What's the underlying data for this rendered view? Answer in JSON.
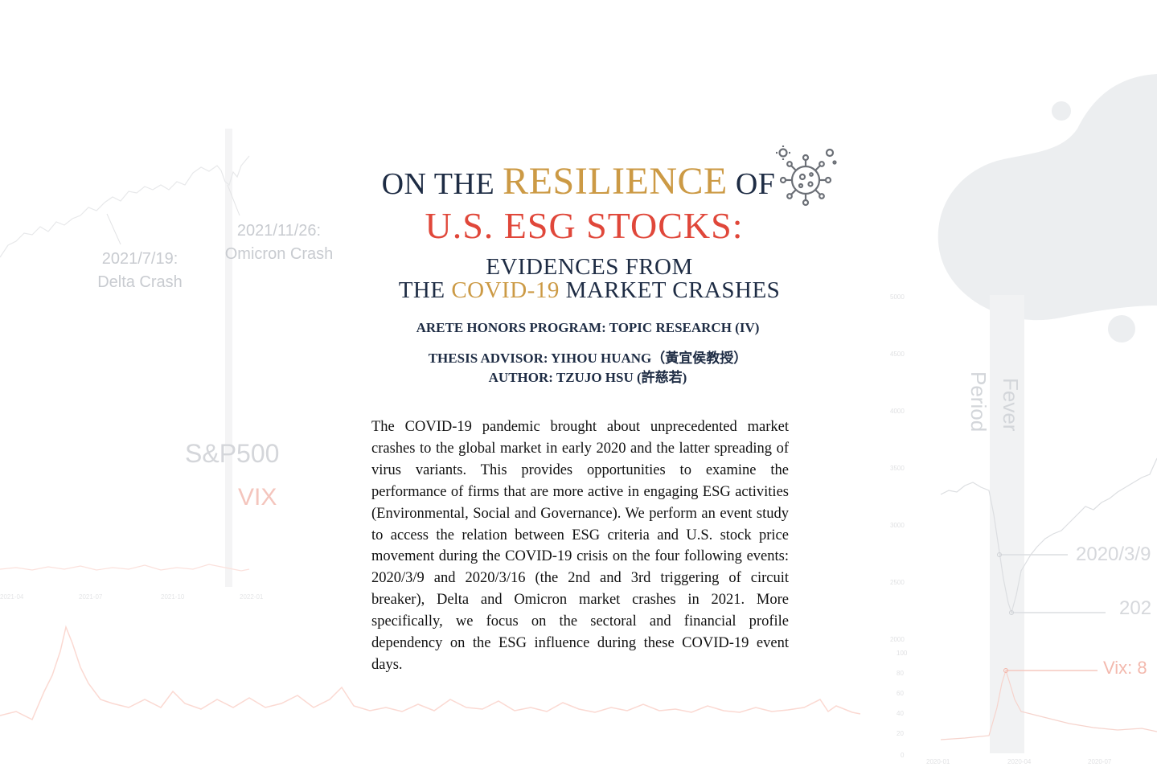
{
  "title": {
    "prefix": "ON THE",
    "highlight": "RESILIENCE",
    "suffix": "OF",
    "line2": "U.S. ESG STOCKS:"
  },
  "subtitle": {
    "line1": "EVIDENCES FROM",
    "line2_prefix": "THE",
    "line2_highlight": "COVID-19",
    "line2_suffix": "MARKET CRASHES"
  },
  "program": "ARETE HONORS PROGRAM: TOPIC RESEARCH (IV)",
  "advisor": "THESIS ADVISOR: YIHOU HUANG（黃宜侯教授）",
  "author": "AUTHOR: TZUJO HSU (許慈若)",
  "abstract": "The COVID-19 pandemic brought about unprecedented market crashes to the global market in early 2020 and the latter spreading of virus variants. This provides opportunities to examine the performance of firms that are more active in engaging ESG activities (Environmental, Social and Governance). We perform an event study to access the relation between ESG criteria and U.S. stock price movement during the COVID-19 crisis on the four following events: 2020/3/9 and 2020/3/16 (the 2nd and 3rd triggering of circuit breaker), Delta and Omicron market crashes in 2021. More specifically, we focus on the sectoral and financial profile dependency on the ESG influence during these COVID-19 event days.",
  "background": {
    "left_annotations": {
      "delta_date": "2021/7/19:",
      "delta_label": "Delta Crash",
      "omicron_date": "2021/11/26:",
      "omicron_label": "Omicron Crash"
    },
    "legend": {
      "sp500": "S&P500",
      "vix": "VIX"
    },
    "right_annotations": {
      "fever_line1": "Fever",
      "fever_line2": "Period",
      "date1": "2020/3/9",
      "date2": "202",
      "vix": "Vix: 8"
    }
  },
  "icons": {
    "virus": "virus-icon"
  },
  "colors": {
    "navy": "#1e2c44",
    "gold": "#cc9a45",
    "red": "#e0473a",
    "faint_gray": "#c8cbd0",
    "faint_pink": "#f4c5bd"
  }
}
